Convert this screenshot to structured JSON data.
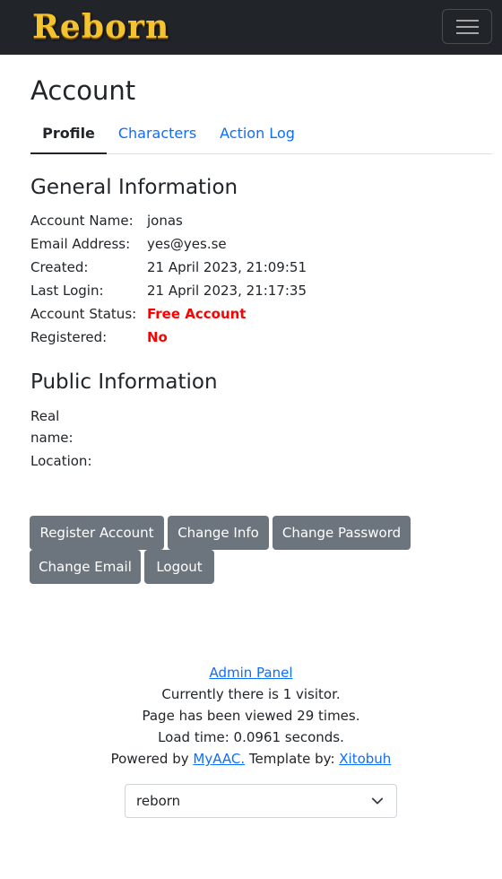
{
  "brand": {
    "logo_text": "Reborn"
  },
  "nav": {
    "toggler_icon": "hamburger-menu-icon"
  },
  "page": {
    "title": "Account"
  },
  "tabs": [
    {
      "label": "Profile",
      "active": true
    },
    {
      "label": "Characters",
      "active": false
    },
    {
      "label": "Action Log",
      "active": false
    }
  ],
  "general": {
    "title": "General Information",
    "rows": [
      {
        "label": "Account Name:",
        "value": "jonas"
      },
      {
        "label": "Email Address:",
        "value": "yes@yes.se"
      },
      {
        "label": "Created:",
        "value": "21 April 2023, 21:09:51"
      },
      {
        "label": "Last Login:",
        "value": "21 April 2023, 21:17:35"
      },
      {
        "label": "Account Status:",
        "value": "Free Account"
      },
      {
        "label": "Registered:",
        "value": "No"
      }
    ]
  },
  "public": {
    "title": "Public Information",
    "real_name_label_1": "Real",
    "real_name_label_2": "name:",
    "location_label": "Location:"
  },
  "buttons": {
    "register": "Register Account",
    "change_info": "Change Info",
    "change_password": "Change Password",
    "change_email": "Change Email",
    "logout": "Logout"
  },
  "footer": {
    "admin_panel": "Admin Panel",
    "visitors": "Currently there is 1 visitor.",
    "views": "Page has been viewed 29 times.",
    "load_time": "Load time: 0.0961 seconds.",
    "powered_by": "Powered by",
    "myaac": "MyAAC.",
    "template_by": "Template by:",
    "author": "Xitobuh"
  },
  "template_select": {
    "value": "reborn"
  },
  "colors": {
    "navbar": "#212529",
    "link": "#0d6efd",
    "status_red": "#ff0000",
    "button": "#6c757d"
  }
}
